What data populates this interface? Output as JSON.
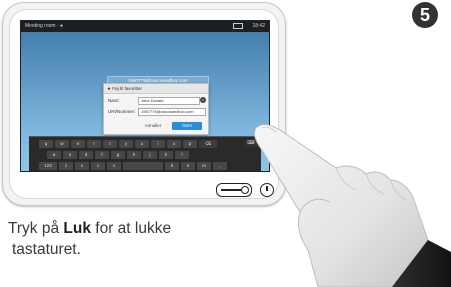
{
  "step": {
    "number": "5"
  },
  "statusbar": {
    "left_text": "Meeting room · ●",
    "right_text": "18:42"
  },
  "uri_bar": {
    "text": "1967778@ciscosandbox.com"
  },
  "dialog": {
    "title": "Føj til favoritter",
    "rows": [
      {
        "label": "Navn:",
        "value": "Jane Donald"
      },
      {
        "label": "URI/Nummer:",
        "value": "1967778@ciscosandbox.com"
      }
    ],
    "cancel_label": "Annuller",
    "save_label": "Gem"
  },
  "keyboard": {
    "row1": [
      "q",
      "w",
      "e",
      "r",
      "t",
      "y",
      "u",
      "i",
      "o",
      "p"
    ],
    "row2": [
      "a",
      "s",
      "d",
      "f",
      "g",
      "h",
      "j",
      "k",
      "l"
    ],
    "row3": [
      "123",
      "z",
      "x",
      "c",
      "v",
      "",
      "b",
      "n",
      "m",
      ",",
      "."
    ],
    "backspace_glyph": "⌫",
    "close_glyph": "⌨"
  },
  "caption": {
    "prefix": "Tryk på ",
    "bold": "Luk",
    "suffix": " for at lukke",
    "line2": "tastaturet."
  },
  "colors": {
    "screen_top": "#3e78a6",
    "screen_bottom": "#8fc5e8",
    "save_button": "#2a8fd8"
  }
}
